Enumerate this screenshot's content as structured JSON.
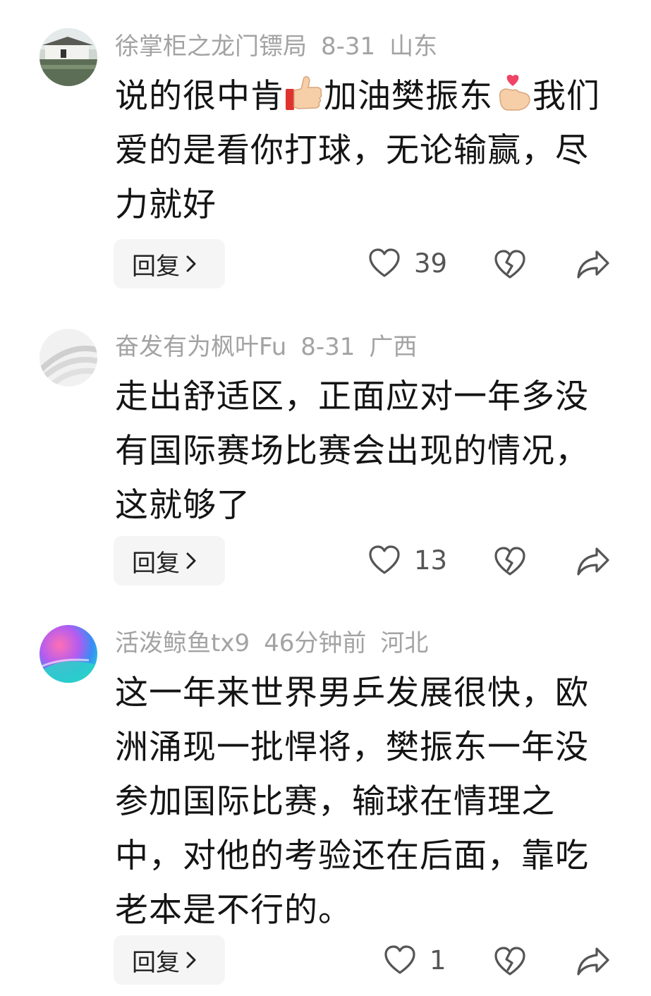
{
  "comments": [
    {
      "user": "徐掌柜之龙门镖局",
      "date": "8-31",
      "location": "山东",
      "text_part1": "说的很中肯",
      "emoji1": "thumbs-up-emoji",
      "text_part2": "加油樊振东",
      "emoji2": "finger-heart-emoji",
      "text_part3": "我们爱的是看你打球，无论输赢，尽力就好",
      "reply_label": "回复",
      "likes": "39"
    },
    {
      "user": "奋发有为枫叶Fu",
      "date": "8-31",
      "location": "广西",
      "text": "走出舒适区，正面应对一年多没有国际赛场比赛会出现的情况，这就够了",
      "reply_label": "回复",
      "likes": "13"
    },
    {
      "user": "活泼鲸鱼tx9",
      "date": "46分钟前",
      "location": "河北",
      "text": "这一年来世界男乒发展很快，欧洲涌现一批悍将，樊振东一年没参加国际比赛，输球在情理之中，对他的考验还在后面，靠吃老本是不行的。",
      "reply_label": "回复",
      "likes": "1"
    }
  ],
  "icons": {
    "like": "heart-outline-icon",
    "dislike": "broken-heart-icon",
    "share": "share-arrow-icon",
    "reply_chevron": "chevron-right-icon"
  },
  "colors": {
    "meta_text": "#a3a3a3",
    "body_text": "#141414",
    "reply_bg": "#f5f5f5",
    "icon_stroke": "#555555"
  }
}
